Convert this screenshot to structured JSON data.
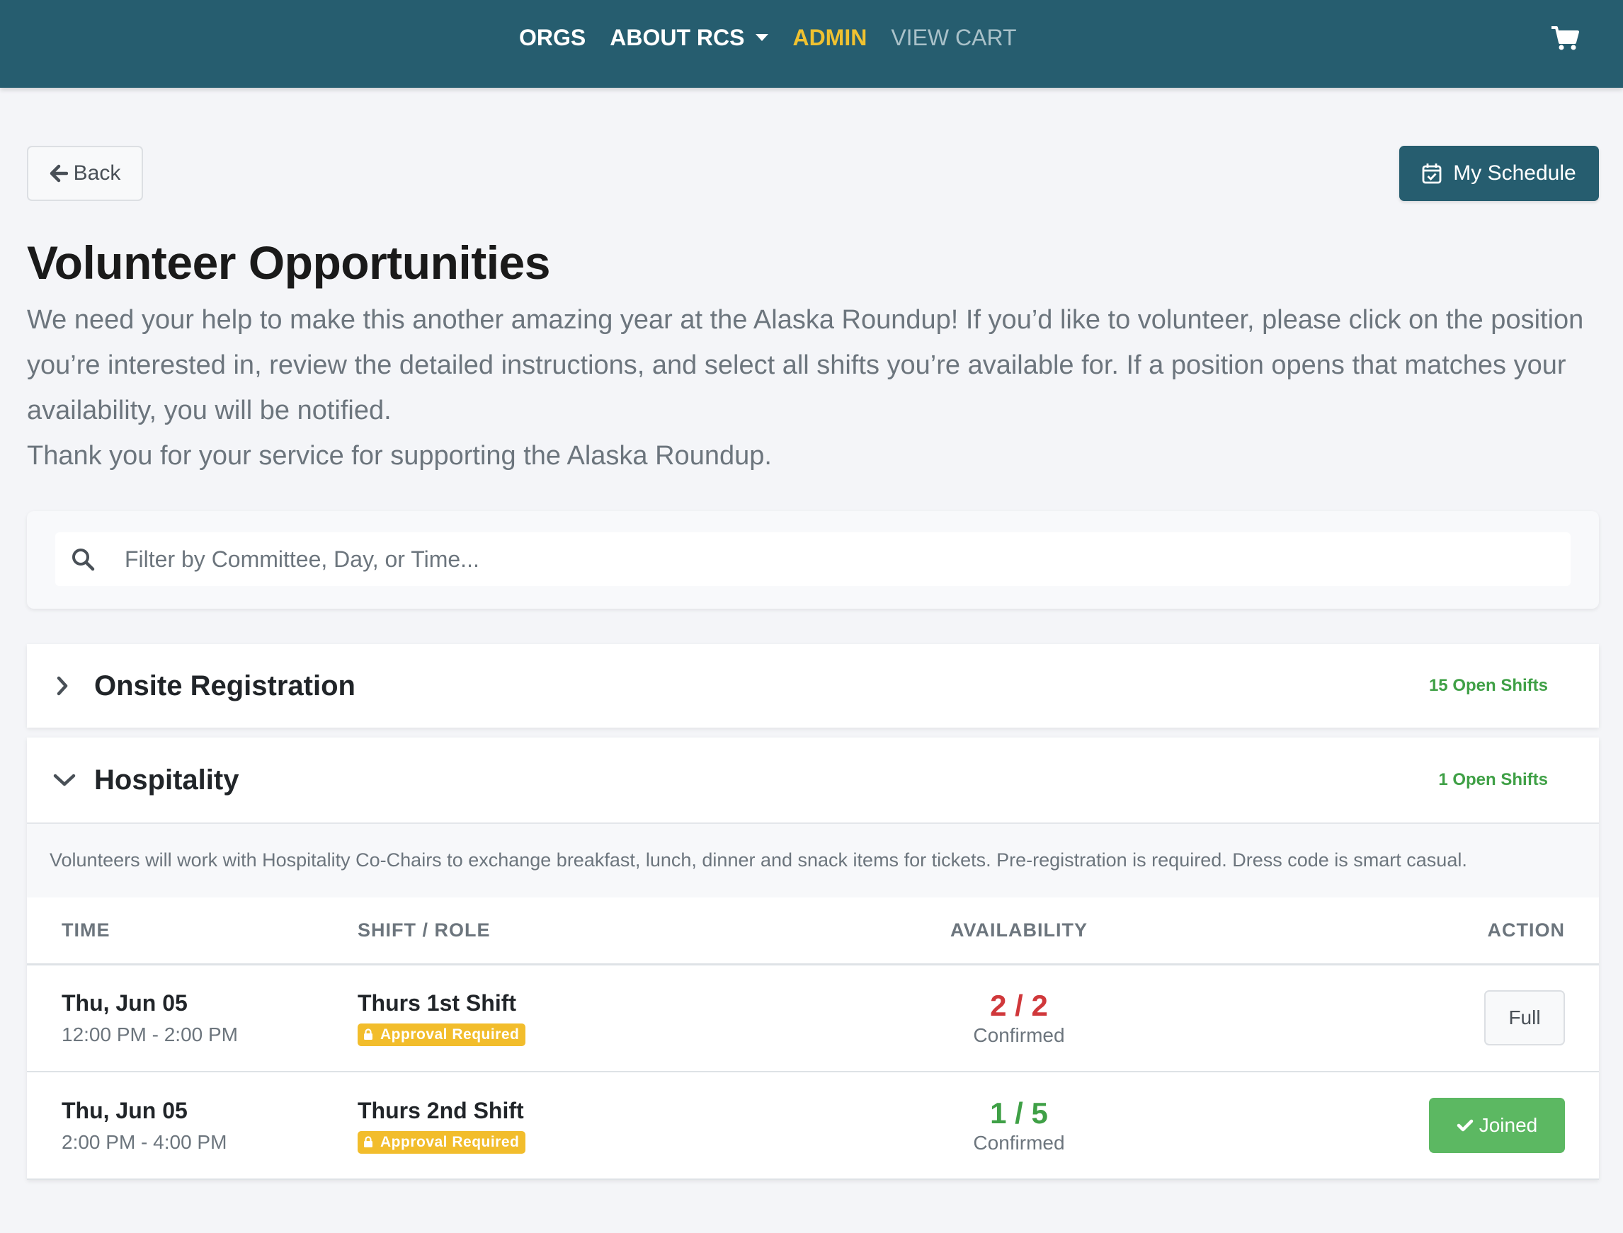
{
  "nav": {
    "links": [
      "ORGS",
      "ABOUT RCS",
      "ADMIN",
      "VIEW CART"
    ],
    "cart_icon": "shopping-cart-icon"
  },
  "toolbar": {
    "back_label": "Back",
    "schedule_label": "My Schedule"
  },
  "page": {
    "title": "Volunteer Opportunities",
    "intro_1": "We need your help to make this another amazing year at the Alaska Roundup! If you’d like to volunteer, please click on the position you’re interested in, review the detailed instructions, and select all shifts you’re available for. If a position opens that matches your availability, you will be notified.",
    "intro_2": "Thank you for your service for supporting the Alaska Roundup."
  },
  "search": {
    "placeholder": "Filter by Committee, Day, or Time...",
    "value": ""
  },
  "committees": [
    {
      "title": "Onsite Registration",
      "open_shifts": "15 Open Shifts",
      "expanded": false
    },
    {
      "title": "Hospitality",
      "open_shifts": "1 Open Shifts",
      "expanded": true,
      "description": "Volunteers will work with Hospitality Co-Chairs to exchange breakfast, lunch, dinner and snack items for tickets. Pre-registration is required. Dress code is smart casual.",
      "columns": [
        "TIME",
        "SHIFT / ROLE",
        "AVAILABILITY",
        "ACTION"
      ],
      "shifts": [
        {
          "date": "Thu, Jun 05",
          "time": "12:00 PM - 2:00 PM",
          "role": "Thurs 1st Shift",
          "badge": "Approval Required",
          "availability": "2 / 2",
          "availability_label": "Confirmed",
          "action": "Full"
        },
        {
          "date": "Thu, Jun 05",
          "time": "2:00 PM - 4:00 PM",
          "role": "Thurs 2nd Shift",
          "badge": "Approval Required",
          "availability": "1 / 5",
          "availability_label": "Confirmed",
          "action": "Joined"
        }
      ]
    }
  ],
  "colors": {
    "navbar": "#265d6f",
    "admin_link": "#f0c230",
    "open_green": "#3fa046",
    "full_red": "#d0383b",
    "badge_yellow": "#f2bd2c",
    "joined_green": "#5cb862"
  }
}
